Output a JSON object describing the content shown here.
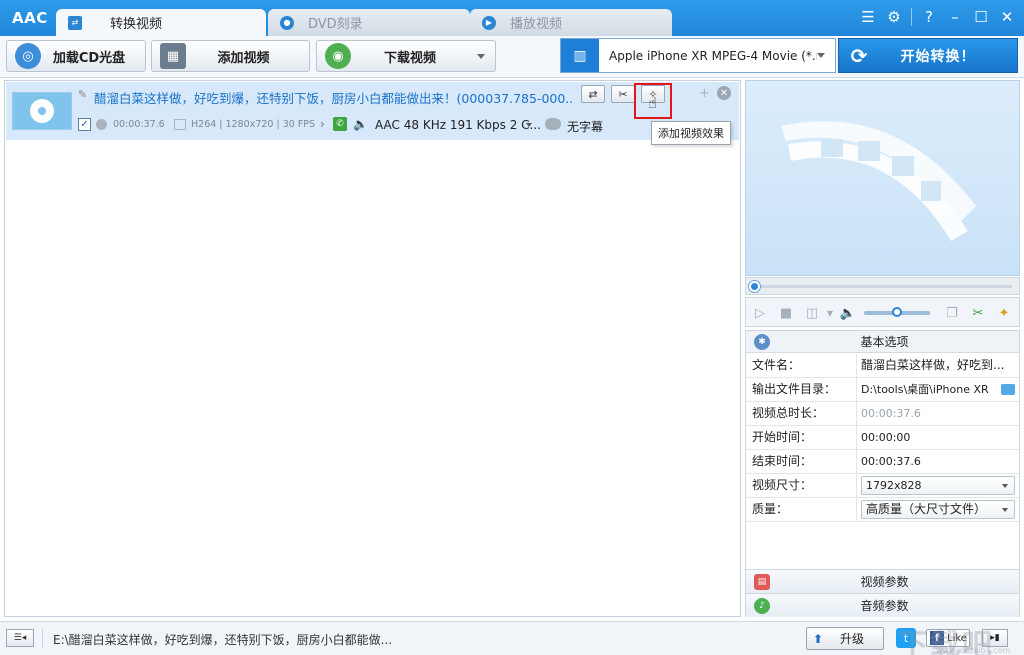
{
  "app": {
    "logo": "AAC",
    "tabs": [
      {
        "label": "转换视频",
        "icon": "convert-icon",
        "active": true
      },
      {
        "label": "DVD刻录",
        "icon": "disc-icon",
        "active": false
      },
      {
        "label": "播放视频",
        "icon": "play-icon",
        "active": false
      }
    ],
    "window_controls": [
      "menu-icon",
      "gear-icon",
      "help-icon",
      "minimize-icon",
      "maximize-icon",
      "close-icon"
    ]
  },
  "toolbar": {
    "load_cd": "加载CD光盘",
    "add_video": "添加视频",
    "download_video": "下载视频",
    "profile": "Apple iPhone XR MPEG-4 Movie (*.m...",
    "start": "开始转换！"
  },
  "file_item": {
    "title": "醋溜白菜这样做，好吃到爆，还特别下饭，厨房小白都能做出来！(000037.785-000...",
    "duration": "00:00:37.6",
    "video_info": "H264 | 1280x720 | 30 FPS",
    "audio_info": "AAC 48 KHz 191 Kbps 2 C...",
    "subtitle": "无字幕",
    "checked": true
  },
  "tooltip": "添加视频效果",
  "properties": {
    "header": "基本选项",
    "rows": [
      {
        "key": "文件名：",
        "value": "醋溜白菜这样做，好吃到..."
      },
      {
        "key": "输出文件目录：",
        "value": "D:\\tools\\桌面\\iPhone XR"
      },
      {
        "key": "视频总时长：",
        "value": "00:00:37.6"
      },
      {
        "key": "开始时间：",
        "value": "00:00:00"
      },
      {
        "key": "结束时间：",
        "value": "00:00:37.6"
      },
      {
        "key": "视频尺寸：",
        "value": "1792x828"
      },
      {
        "key": "质量：",
        "value": "高质量（大尺寸文件）"
      }
    ],
    "video_params": "视频参数",
    "audio_params": "音频参数"
  },
  "status": {
    "path": "E:\\醋溜白菜这样做，好吃到爆，还特别下饭，厨房小白都能做...",
    "upgrade": "升级",
    "like": "Like"
  },
  "watermark": {
    "brand": "下载吧",
    "url": "www.xiazaiba.com"
  },
  "colors": {
    "accent": "#1f86d9",
    "title_link": "#1a73c8",
    "highlight": "#e01818",
    "item_bg": "#d6e8fa"
  }
}
